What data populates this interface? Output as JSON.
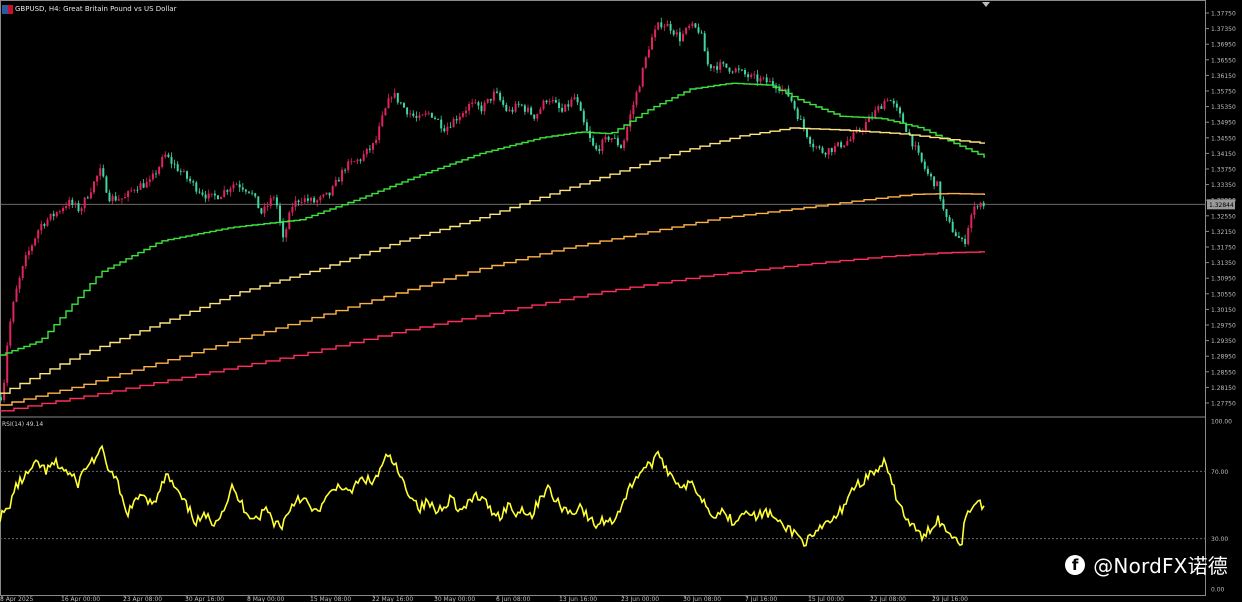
{
  "header": {
    "symbol_line": "GBPUSD, H4:  Great Britain Pound vs US Dollar"
  },
  "rsi_label": "RSI(14) 49.14",
  "watermark": {
    "icon": "facebook-icon",
    "text": "@NordFX诺德"
  },
  "colors": {
    "background": "#000000",
    "bull_candle": "#e0245e",
    "bear_candle": "#3fd6a0",
    "ma_fast": "#3ee23e",
    "ma_mid": "#ffe680",
    "ma_slow": "#ffb347",
    "ma_long": "#ff2f5c",
    "rsi": "#ffff33",
    "axis_text": "#bdbdbd"
  },
  "chart_data": [
    {
      "type": "candlestick",
      "symbol": "GBPUSD",
      "timeframe": "H4",
      "y_ticks": [
        "1.37750",
        "1.37350",
        "1.36950",
        "1.36550",
        "1.36150",
        "1.35750",
        "1.35350",
        "1.34950",
        "1.34550",
        "1.34150",
        "1.33750",
        "1.33350",
        "1.32950",
        "1.32550",
        "1.32150",
        "1.31750",
        "1.31350",
        "1.30950",
        "1.30550",
        "1.30150",
        "1.29750",
        "1.29350",
        "1.28950",
        "1.28550",
        "1.28150",
        "1.27750"
      ],
      "ylim": [
        1.2745,
        1.379
      ],
      "current_price": "1.32844",
      "x_ticks": [
        "8 Apr 2025",
        "16 Apr 00:00",
        "23 Apr 08:00",
        "30 Apr 16:00",
        "8 May 00:00",
        "15 May 08:00",
        "22 May 16:00",
        "30 May 00:00",
        "6 Jun 08:00",
        "13 Jun 16:00",
        "23 Jun 00:00",
        "30 Jun 08:00",
        "7 Jul 16:00",
        "15 Jul 00:00",
        "22 Jul 08:00",
        "29 Jul 16:00"
      ],
      "price_path": [
        [
          0,
          1.279
        ],
        [
          3,
          1.28
        ],
        [
          8,
          1.295
        ],
        [
          15,
          1.305
        ],
        [
          25,
          1.314
        ],
        [
          40,
          1.323
        ],
        [
          55,
          1.326
        ],
        [
          68,
          1.329
        ],
        [
          80,
          1.327
        ],
        [
          100,
          1.337
        ],
        [
          110,
          1.33
        ],
        [
          125,
          1.33
        ],
        [
          135,
          1.333
        ],
        [
          150,
          1.334
        ],
        [
          165,
          1.341
        ],
        [
          180,
          1.337
        ],
        [
          195,
          1.333
        ],
        [
          210,
          1.33
        ],
        [
          220,
          1.331
        ],
        [
          235,
          1.334
        ],
        [
          250,
          1.332
        ],
        [
          262,
          1.326
        ],
        [
          275,
          1.331
        ],
        [
          283,
          1.319
        ],
        [
          292,
          1.328
        ],
        [
          300,
          1.33
        ],
        [
          315,
          1.329
        ],
        [
          330,
          1.331
        ],
        [
          345,
          1.338
        ],
        [
          360,
          1.34
        ],
        [
          375,
          1.344
        ],
        [
          383,
          1.351
        ],
        [
          392,
          1.357
        ],
        [
          405,
          1.353
        ],
        [
          418,
          1.35
        ],
        [
          430,
          1.352
        ],
        [
          445,
          1.348
        ],
        [
          458,
          1.351
        ],
        [
          470,
          1.354
        ],
        [
          482,
          1.353
        ],
        [
          495,
          1.357
        ],
        [
          508,
          1.352
        ],
        [
          520,
          1.354
        ],
        [
          535,
          1.351
        ],
        [
          548,
          1.356
        ],
        [
          562,
          1.352
        ],
        [
          575,
          1.356
        ],
        [
          585,
          1.348
        ],
        [
          595,
          1.342
        ],
        [
          610,
          1.346
        ],
        [
          622,
          1.343
        ],
        [
          630,
          1.351
        ],
        [
          640,
          1.36
        ],
        [
          650,
          1.37
        ],
        [
          660,
          1.375
        ],
        [
          670,
          1.374
        ],
        [
          680,
          1.371
        ],
        [
          690,
          1.374
        ],
        [
          700,
          1.373
        ],
        [
          708,
          1.364
        ],
        [
          720,
          1.364
        ],
        [
          735,
          1.363
        ],
        [
          750,
          1.361
        ],
        [
          765,
          1.36
        ],
        [
          778,
          1.359
        ],
        [
          790,
          1.356
        ],
        [
          800,
          1.35
        ],
        [
          812,
          1.344
        ],
        [
          822,
          1.342
        ],
        [
          835,
          1.343
        ],
        [
          850,
          1.345
        ],
        [
          862,
          1.348
        ],
        [
          875,
          1.352
        ],
        [
          888,
          1.356
        ],
        [
          898,
          1.352
        ],
        [
          908,
          1.347
        ],
        [
          918,
          1.341
        ],
        [
          928,
          1.336
        ],
        [
          938,
          1.333
        ],
        [
          945,
          1.325
        ],
        [
          955,
          1.321
        ],
        [
          964,
          1.318
        ],
        [
          970,
          1.325
        ],
        [
          978,
          1.329
        ],
        [
          985,
          1.3284
        ]
      ],
      "moving_averages": [
        {
          "name": "",
          "color": "#3ee23e",
          "values": [
            [
              0,
              1.2898
            ],
            [
              40,
              1.2935
            ],
            [
              100,
              1.311
            ],
            [
              160,
              1.319
            ],
            [
              230,
              1.3225
            ],
            [
              300,
              1.3245
            ],
            [
              360,
              1.33
            ],
            [
              420,
              1.336
            ],
            [
              480,
              1.3415
            ],
            [
              540,
              1.3455
            ],
            [
              580,
              1.347
            ],
            [
              610,
              1.3465
            ],
            [
              650,
              1.353
            ],
            [
              690,
              1.358
            ],
            [
              730,
              1.3595
            ],
            [
              770,
              1.359
            ],
            [
              800,
              1.355
            ],
            [
              840,
              1.351
            ],
            [
              880,
              1.3505
            ],
            [
              920,
              1.348
            ],
            [
              950,
              1.3445
            ],
            [
              985,
              1.3405
            ]
          ]
        },
        {
          "name": "",
          "color": "#ffe680",
          "values": [
            [
              0,
              1.28
            ],
            [
              80,
              1.29
            ],
            [
              160,
              1.298
            ],
            [
              240,
              1.306
            ],
            [
              320,
              1.312
            ],
            [
              400,
              1.319
            ],
            [
              480,
              1.325
            ],
            [
              560,
              1.332
            ],
            [
              620,
              1.337
            ],
            [
              680,
              1.342
            ],
            [
              740,
              1.346
            ],
            [
              790,
              1.348
            ],
            [
              840,
              1.3475
            ],
            [
              900,
              1.3465
            ],
            [
              950,
              1.345
            ],
            [
              985,
              1.344
            ]
          ]
        },
        {
          "name": "",
          "color": "#ffb347",
          "values": [
            [
              0,
              1.277
            ],
            [
              80,
              1.282
            ],
            [
              160,
              1.288
            ],
            [
              240,
              1.294
            ],
            [
              320,
              1.3
            ],
            [
              400,
              1.306
            ],
            [
              480,
              1.312
            ],
            [
              560,
              1.317
            ],
            [
              640,
              1.321
            ],
            [
              720,
              1.325
            ],
            [
              800,
              1.3275
            ],
            [
              860,
              1.3295
            ],
            [
              910,
              1.331
            ],
            [
              950,
              1.3312
            ],
            [
              985,
              1.331
            ]
          ]
        },
        {
          "name": "",
          "color": "#ff2f5c",
          "values": [
            [
              0,
              1.2755
            ],
            [
              100,
              1.28
            ],
            [
              200,
              1.285
            ],
            [
              300,
              1.29
            ],
            [
              400,
              1.296
            ],
            [
              500,
              1.301
            ],
            [
              600,
              1.306
            ],
            [
              700,
              1.31
            ],
            [
              800,
              1.313
            ],
            [
              880,
              1.315
            ],
            [
              940,
              1.316
            ],
            [
              985,
              1.3163
            ]
          ]
        }
      ]
    },
    {
      "type": "line",
      "name": "RSI(14)",
      "value": 49.14,
      "y_ticks": [
        "100.00",
        "70.00",
        "30.00",
        "0.00"
      ],
      "levels": [
        70,
        30
      ],
      "ylim": [
        0,
        100
      ],
      "values": [
        [
          0,
          43
        ],
        [
          8,
          47
        ],
        [
          15,
          60
        ],
        [
          22,
          65
        ],
        [
          30,
          70
        ],
        [
          38,
          75
        ],
        [
          46,
          70
        ],
        [
          55,
          75
        ],
        [
          62,
          72
        ],
        [
          70,
          68
        ],
        [
          78,
          63
        ],
        [
          85,
          72
        ],
        [
          95,
          78
        ],
        [
          102,
          82
        ],
        [
          110,
          70
        ],
        [
          118,
          62
        ],
        [
          126,
          45
        ],
        [
          134,
          50
        ],
        [
          142,
          58
        ],
        [
          150,
          52
        ],
        [
          158,
          55
        ],
        [
          166,
          68
        ],
        [
          172,
          63
        ],
        [
          180,
          55
        ],
        [
          188,
          48
        ],
        [
          196,
          40
        ],
        [
          205,
          43
        ],
        [
          214,
          40
        ],
        [
          224,
          48
        ],
        [
          232,
          60
        ],
        [
          240,
          52
        ],
        [
          248,
          45
        ],
        [
          258,
          42
        ],
        [
          266,
          48
        ],
        [
          274,
          40
        ],
        [
          282,
          38
        ],
        [
          290,
          48
        ],
        [
          298,
          55
        ],
        [
          306,
          52
        ],
        [
          314,
          45
        ],
        [
          322,
          50
        ],
        [
          330,
          56
        ],
        [
          340,
          63
        ],
        [
          348,
          56
        ],
        [
          356,
          62
        ],
        [
          364,
          66
        ],
        [
          372,
          63
        ],
        [
          380,
          70
        ],
        [
          388,
          80
        ],
        [
          396,
          72
        ],
        [
          404,
          62
        ],
        [
          412,
          55
        ],
        [
          420,
          48
        ],
        [
          428,
          52
        ],
        [
          436,
          46
        ],
        [
          444,
          50
        ],
        [
          452,
          55
        ],
        [
          460,
          46
        ],
        [
          468,
          50
        ],
        [
          476,
          56
        ],
        [
          484,
          52
        ],
        [
          492,
          47
        ],
        [
          500,
          43
        ],
        [
          508,
          50
        ],
        [
          516,
          45
        ],
        [
          524,
          48
        ],
        [
          532,
          43
        ],
        [
          540,
          55
        ],
        [
          548,
          60
        ],
        [
          556,
          52
        ],
        [
          564,
          48
        ],
        [
          572,
          45
        ],
        [
          580,
          50
        ],
        [
          588,
          42
        ],
        [
          596,
          38
        ],
        [
          604,
          41
        ],
        [
          612,
          40
        ],
        [
          620,
          48
        ],
        [
          628,
          58
        ],
        [
          636,
          67
        ],
        [
          644,
          72
        ],
        [
          652,
          75
        ],
        [
          660,
          80
        ],
        [
          668,
          70
        ],
        [
          676,
          65
        ],
        [
          684,
          60
        ],
        [
          692,
          63
        ],
        [
          700,
          56
        ],
        [
          708,
          48
        ],
        [
          716,
          44
        ],
        [
          724,
          47
        ],
        [
          732,
          40
        ],
        [
          740,
          44
        ],
        [
          748,
          48
        ],
        [
          756,
          42
        ],
        [
          764,
          46
        ],
        [
          772,
          44
        ],
        [
          780,
          38
        ],
        [
          788,
          36
        ],
        [
          796,
          33
        ],
        [
          804,
          28
        ],
        [
          812,
          30
        ],
        [
          820,
          35
        ],
        [
          828,
          40
        ],
        [
          836,
          42
        ],
        [
          844,
          50
        ],
        [
          852,
          60
        ],
        [
          860,
          63
        ],
        [
          868,
          67
        ],
        [
          876,
          70
        ],
        [
          884,
          75
        ],
        [
          892,
          62
        ],
        [
          900,
          50
        ],
        [
          908,
          40
        ],
        [
          916,
          35
        ],
        [
          924,
          30
        ],
        [
          930,
          36
        ],
        [
          938,
          42
        ],
        [
          946,
          35
        ],
        [
          954,
          32
        ],
        [
          962,
          28
        ],
        [
          966,
          46
        ],
        [
          972,
          49
        ],
        [
          978,
          52
        ],
        [
          985,
          49.14
        ]
      ]
    }
  ]
}
